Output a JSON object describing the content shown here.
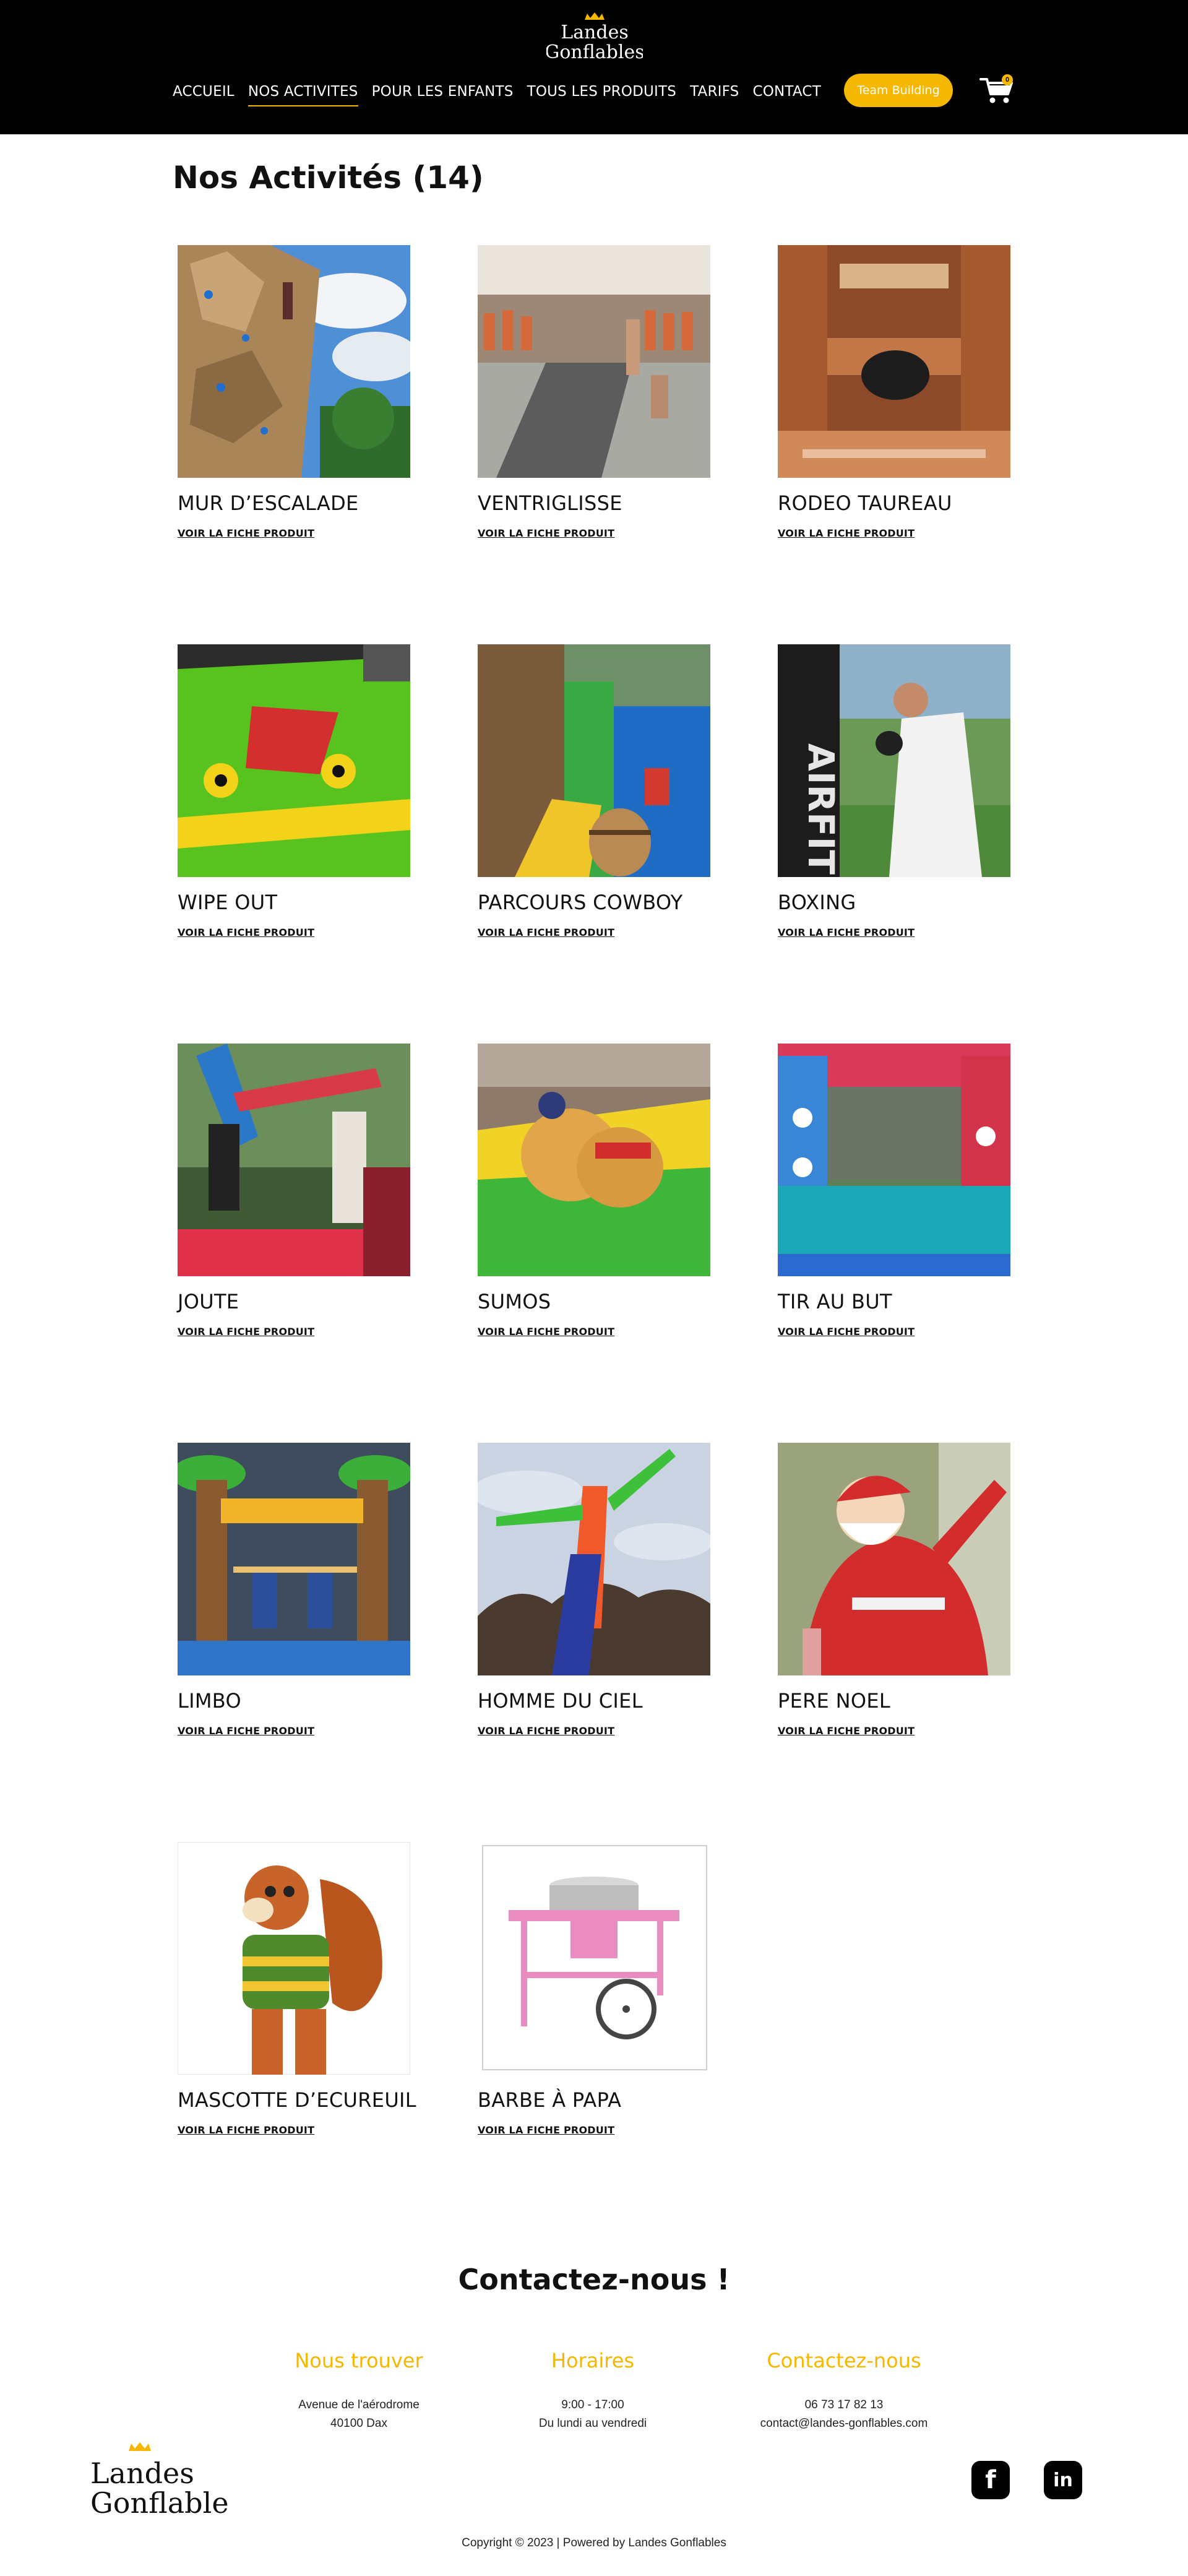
{
  "header": {
    "logo_text": [
      "Landes",
      "Gonflables"
    ],
    "nav": [
      {
        "label": "ACCUEIL"
      },
      {
        "label": "NOS ACTIVITES",
        "active": true
      },
      {
        "label": "POUR LES ENFANTS"
      },
      {
        "label": "TOUS LES PRODUITS"
      },
      {
        "label": "TARIFS"
      },
      {
        "label": "CONTACT"
      }
    ],
    "cta_label": "Team Building",
    "cart_count": "0",
    "cart_icon": "shopping-cart-icon"
  },
  "page": {
    "title": "Nos Activités (14)"
  },
  "products": [
    {
      "name": "MUR D’ESCALADE",
      "link": "VOIR LA FICHE PRODUIT"
    },
    {
      "name": "VENTRIGLISSE",
      "link": "VOIR LA FICHE PRODUIT"
    },
    {
      "name": "RODEO TAUREAU",
      "link": "VOIR LA FICHE PRODUIT"
    },
    {
      "name": "WIPE OUT",
      "link": "VOIR LA FICHE PRODUIT"
    },
    {
      "name": "PARCOURS COWBOY",
      "link": "VOIR LA FICHE PRODUIT"
    },
    {
      "name": "BOXING",
      "link": "VOIR LA FICHE PRODUIT",
      "photo_text": "AIRFIT"
    },
    {
      "name": "JOUTE",
      "link": "VOIR LA FICHE PRODUIT"
    },
    {
      "name": "SUMOS",
      "link": "VOIR LA FICHE PRODUIT"
    },
    {
      "name": "TIR AU BUT",
      "link": "VOIR LA FICHE PRODUIT"
    },
    {
      "name": "LIMBO",
      "link": "VOIR LA FICHE PRODUIT"
    },
    {
      "name": "HOMME DU CIEL",
      "link": "VOIR LA FICHE PRODUIT"
    },
    {
      "name": "PERE NOEL",
      "link": "VOIR LA FICHE PRODUIT"
    },
    {
      "name": "MASCOTTE D’ECUREUIL",
      "link": "VOIR LA FICHE PRODUIT"
    },
    {
      "name": "BARBE À PAPA",
      "link": "VOIR LA FICHE PRODUIT"
    }
  ],
  "contact": {
    "title": "Contactez-nous !",
    "columns": [
      {
        "heading": "Nous trouver",
        "lines": [
          "Avenue de l'aérodrome",
          "40100 Dax"
        ]
      },
      {
        "heading": "Horaires",
        "lines": [
          "9:00 - 17:00",
          "Du lundi au vendredi"
        ]
      },
      {
        "heading": "Contactez-nous",
        "lines": [
          "06 73 17 82 13",
          "contact@landes-gonflables.com"
        ]
      }
    ]
  },
  "footer": {
    "social": [
      {
        "icon": "facebook-icon",
        "glyph": "f"
      },
      {
        "icon": "linkedin-icon",
        "glyph": "in"
      }
    ],
    "copyright": "Copyright © 2023 | Powered by Landes Gonflables"
  },
  "colors": {
    "accent": "#f5b700",
    "header_bg": "#000000"
  }
}
